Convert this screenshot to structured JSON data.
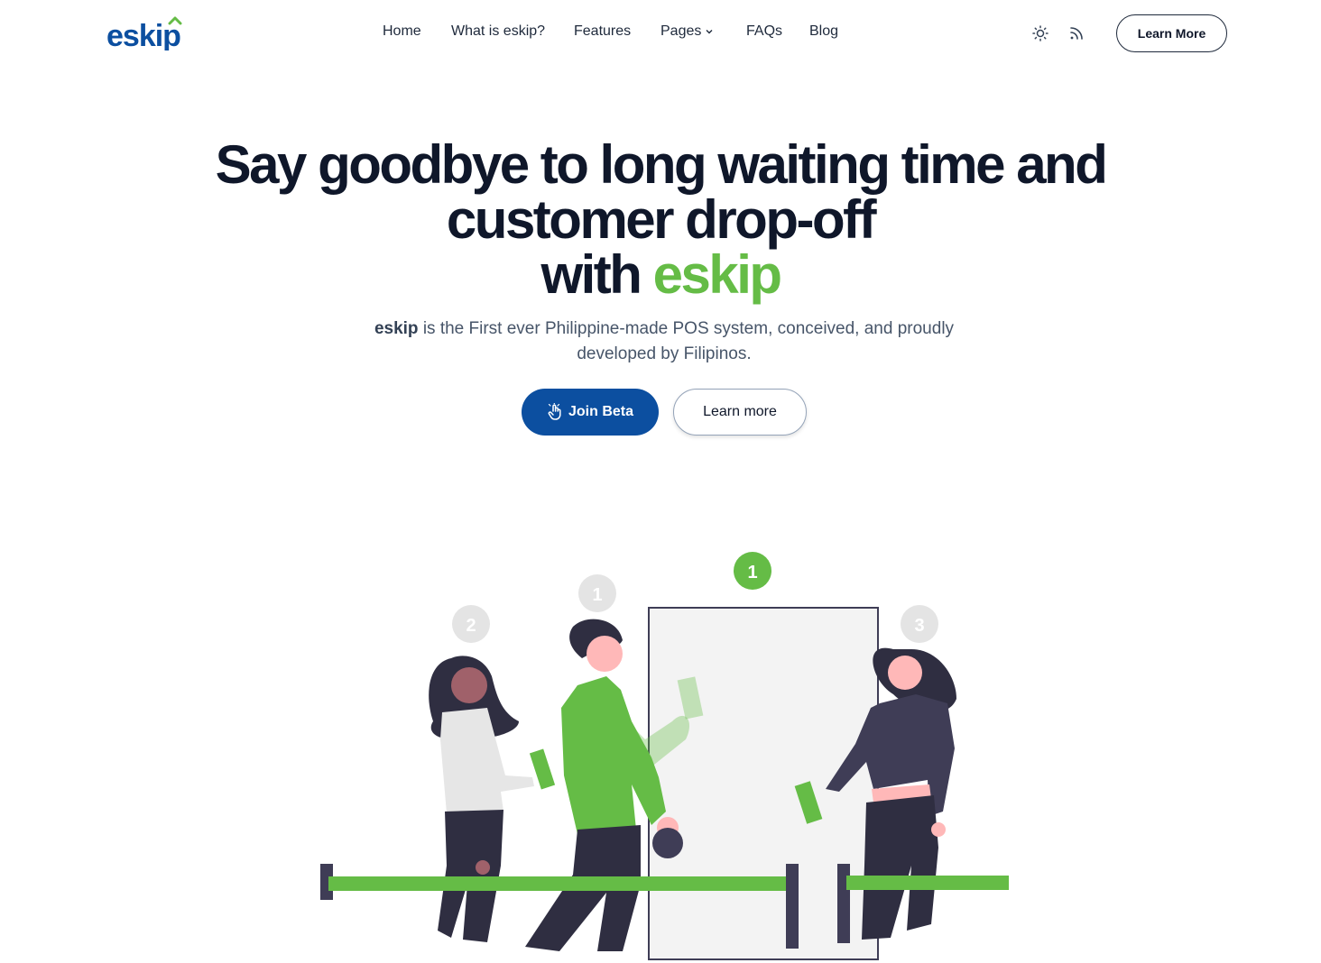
{
  "brand": {
    "logo_text": "eskip",
    "primary_color": "#0c4fa0",
    "accent_color": "#65bc46"
  },
  "nav": {
    "items": [
      {
        "label": "Home"
      },
      {
        "label": "What is eskip?"
      },
      {
        "label": "Features"
      },
      {
        "label": "Pages",
        "has_dropdown": true
      },
      {
        "label": "FAQs"
      },
      {
        "label": "Blog"
      }
    ],
    "theme_toggle_icon": "sun-icon",
    "rss_icon": "rss-icon",
    "cta_label": "Learn More"
  },
  "hero": {
    "title_line1": "Say goodbye to long waiting time and",
    "title_line2": "customer drop-off",
    "title_line3_prefix": "with ",
    "title_line3_accent": "eskip",
    "subtitle_brand": "eskip",
    "subtitle_rest": " is the First ever Philippine-made POS system, conceived, and proudly developed by Filipinos.",
    "primary_button": "Join Beta",
    "primary_button_icon": "hand-pointer-icon",
    "secondary_button": "Learn more"
  },
  "illustration": {
    "badges": [
      "2",
      "1",
      "1",
      "3"
    ]
  }
}
